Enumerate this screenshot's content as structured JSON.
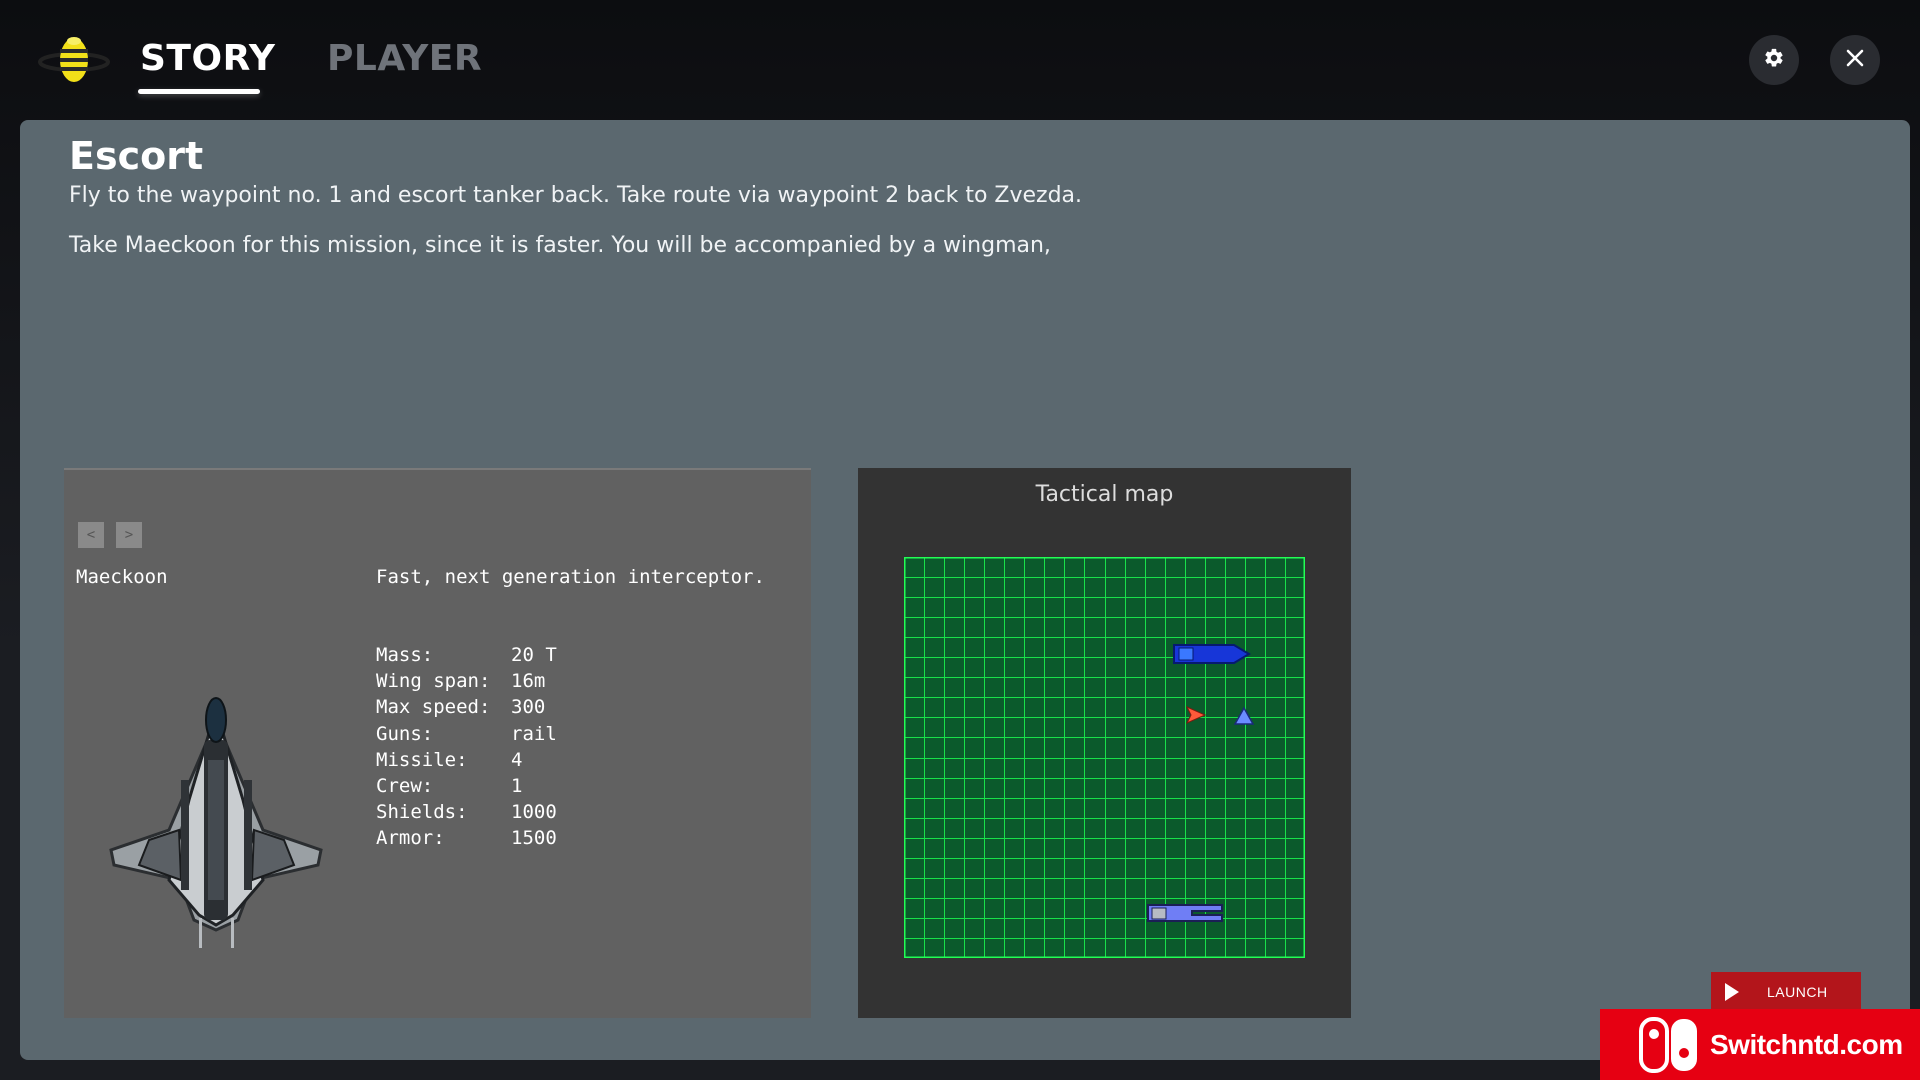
{
  "header": {
    "tabs": [
      {
        "label": "STORY",
        "active": true
      },
      {
        "label": "PLAYER",
        "active": false
      }
    ],
    "icons": [
      "bee-logo-icon",
      "gear-icon",
      "close-icon"
    ]
  },
  "mission": {
    "title": "Escort",
    "lines": [
      "Fly to the waypoint no. 1 and escort tanker back. Take route via waypoint 2 back to Zvezda.",
      "Take Maeckoon for this mission, since it is faster. You will be accompanied by a wingman,"
    ]
  },
  "ship": {
    "nav_prev": "<",
    "nav_next": ">",
    "name": "Maeckoon",
    "description": "Fast, next generation interceptor.",
    "stats": [
      {
        "label": "Mass:",
        "value": "20 T"
      },
      {
        "label": "Wing span:",
        "value": "16m"
      },
      {
        "label": "Max speed:",
        "value": "300"
      },
      {
        "label": "Guns:",
        "value": "rail"
      },
      {
        "label": "Missile:",
        "value": "4"
      },
      {
        "label": "Crew:",
        "value": "1"
      },
      {
        "label": "Shields:",
        "value": "1000"
      },
      {
        "label": "Armor:",
        "value": "1500"
      }
    ]
  },
  "tactical_map": {
    "title": "Tactical map",
    "grid_color": "#19e04a",
    "background": "#0b5a2c"
  },
  "launch": {
    "label": "LAUNCH"
  },
  "watermark": {
    "text": "Switchntd.com"
  },
  "colors": {
    "panel": "#5b686f",
    "ship_panel": "#616161",
    "map_panel": "#333333",
    "launch": "#b3151b",
    "watermark": "#e60012"
  }
}
